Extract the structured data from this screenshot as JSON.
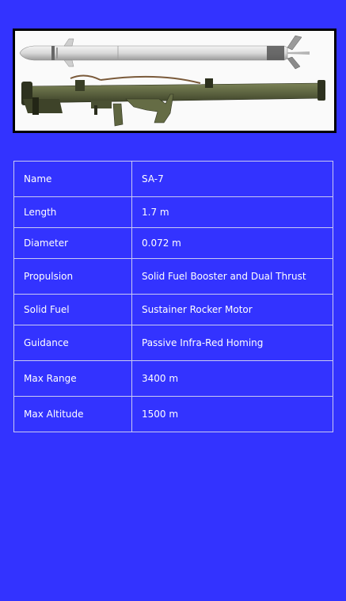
{
  "image": {
    "subject": "missile-and-launcher-photo"
  },
  "specs": [
    {
      "label": "Name",
      "value": "SA-7"
    },
    {
      "label": "Length",
      "value": "1.7 m"
    },
    {
      "label": "Diameter",
      "value": "0.072 m"
    },
    {
      "label": "Propulsion",
      "value": "Solid Fuel Booster and Dual Thrust"
    },
    {
      "label": "Solid Fuel",
      "value": "Sustainer Rocker Motor"
    },
    {
      "label": "Guidance",
      "value": "Passive Infra-Red Homing"
    },
    {
      "label": "Max Range",
      "value": "3400 m"
    },
    {
      "label": "Max Altitude",
      "value": "1500 m"
    }
  ],
  "colors": {
    "background": "#3333ff",
    "text": "#ffffff",
    "border": "#c9c9f2",
    "frame": "#000000",
    "launcher": "#5d6440",
    "missile": "#dcdcdc"
  }
}
